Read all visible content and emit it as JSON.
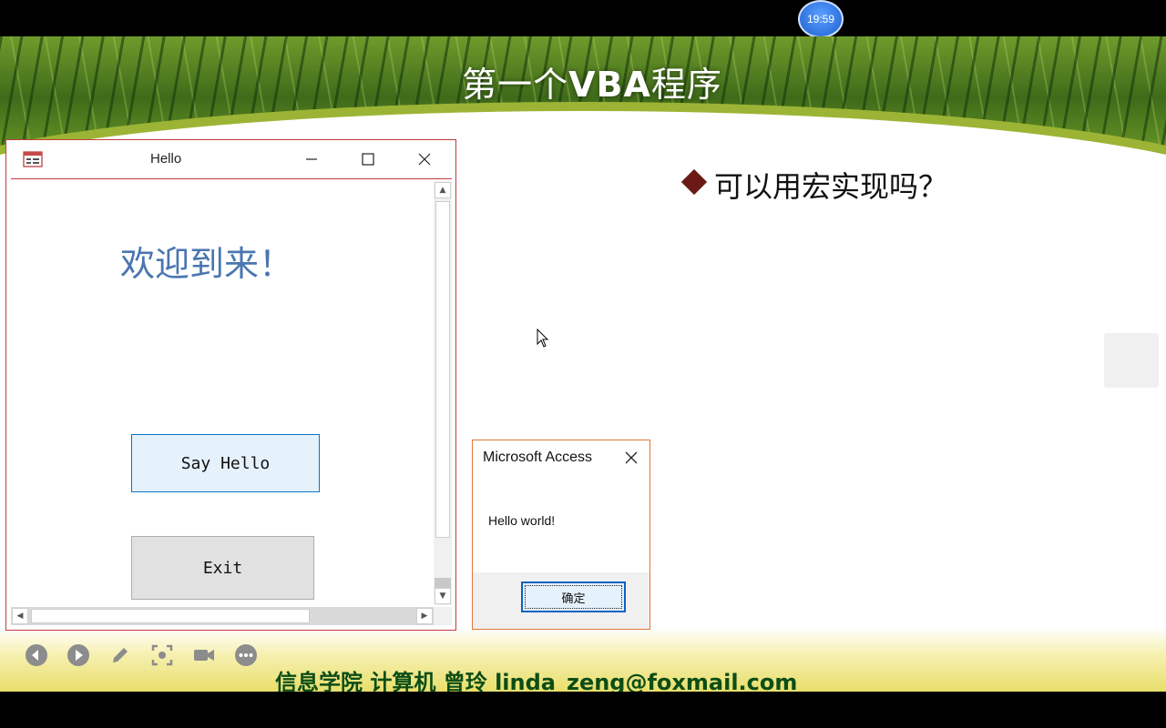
{
  "clock": {
    "time": "19:59"
  },
  "slide": {
    "title_prefix": "第一个",
    "title_bold": "VBA",
    "title_suffix": "程序",
    "bullet": "可以用宏实现吗？",
    "footer": "信息学院 计算机 曾玲 linda_zeng@foxmail.com",
    "colors": {
      "bullet_marker": "#6b1a16",
      "footer_text": "#0c4d16"
    }
  },
  "player_controls": [
    {
      "icon": "previous-icon"
    },
    {
      "icon": "play-icon"
    },
    {
      "icon": "pen-icon"
    },
    {
      "icon": "screenshot-icon"
    },
    {
      "icon": "camera-icon"
    },
    {
      "icon": "more-icon"
    }
  ],
  "form_window": {
    "title": "Hello",
    "welcome": "欢迎到来！",
    "say_hello_label": "Say Hello",
    "exit_label": "Exit",
    "accent": "#c43a3a"
  },
  "message_box": {
    "title": "Microsoft Access",
    "message": "Hello world!",
    "ok_label": "确定",
    "accent": "#e0773a"
  }
}
